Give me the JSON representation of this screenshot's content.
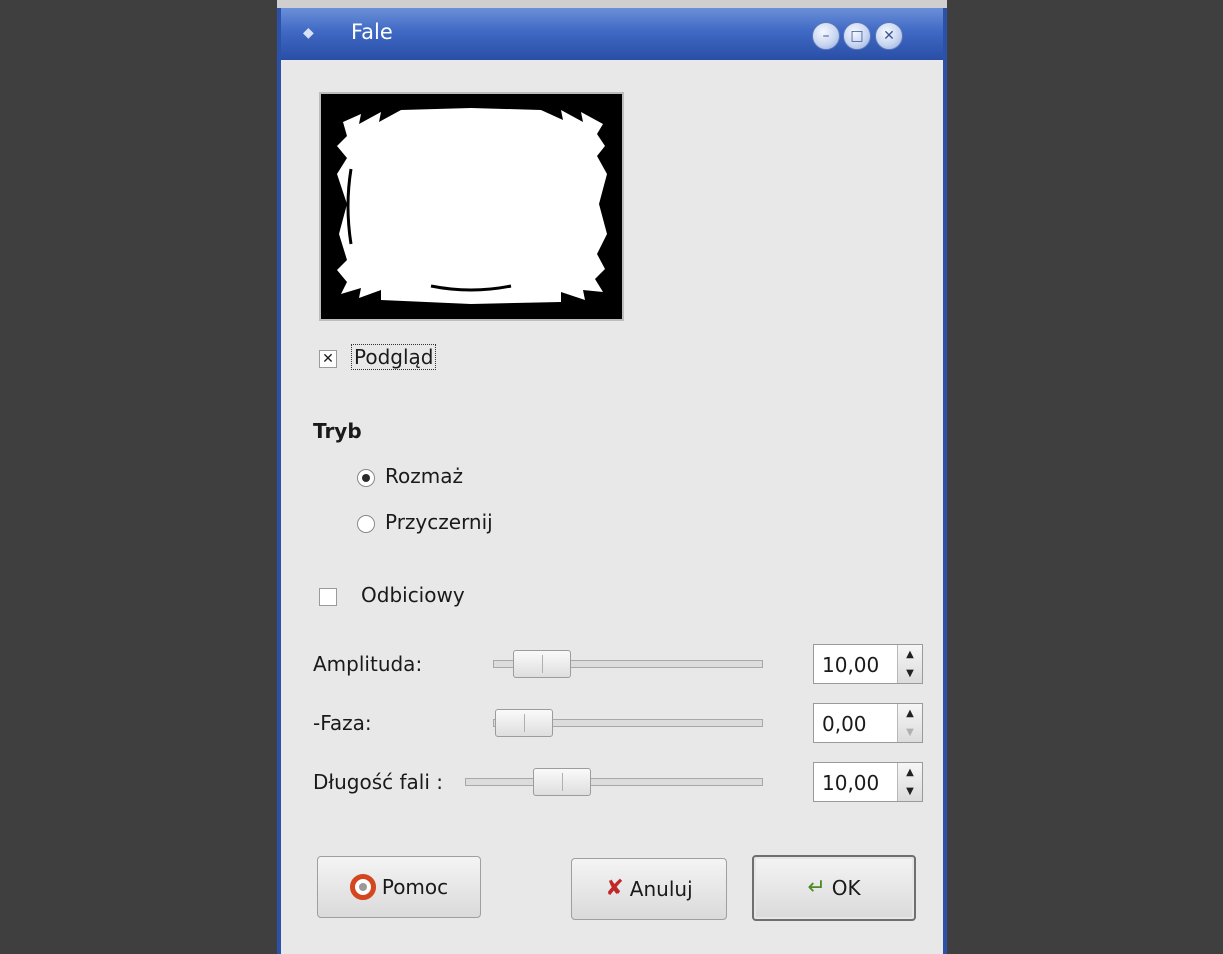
{
  "window": {
    "title": "Fale"
  },
  "preview": {
    "checkbox_label": "Podgląd",
    "checked": true
  },
  "mode": {
    "heading": "Tryb",
    "options": [
      {
        "label": "Rozmaż",
        "selected": true
      },
      {
        "label": "Przyczernij",
        "selected": false
      }
    ]
  },
  "reflective": {
    "label": "Odbiciowy",
    "checked": false
  },
  "params": [
    {
      "label": "Amplituda:",
      "value": "10,00"
    },
    {
      "label": "-Faza:",
      "value": "0,00"
    },
    {
      "label": "Długość fali :",
      "value": "10,00"
    }
  ],
  "buttons": {
    "help": "Pomoc",
    "cancel": "Anuluj",
    "ok": "OK"
  },
  "colors": {
    "titlebar": "#3f69c4",
    "dialog_bg": "#e8e8e8",
    "backdrop": "#3e3f3e"
  }
}
